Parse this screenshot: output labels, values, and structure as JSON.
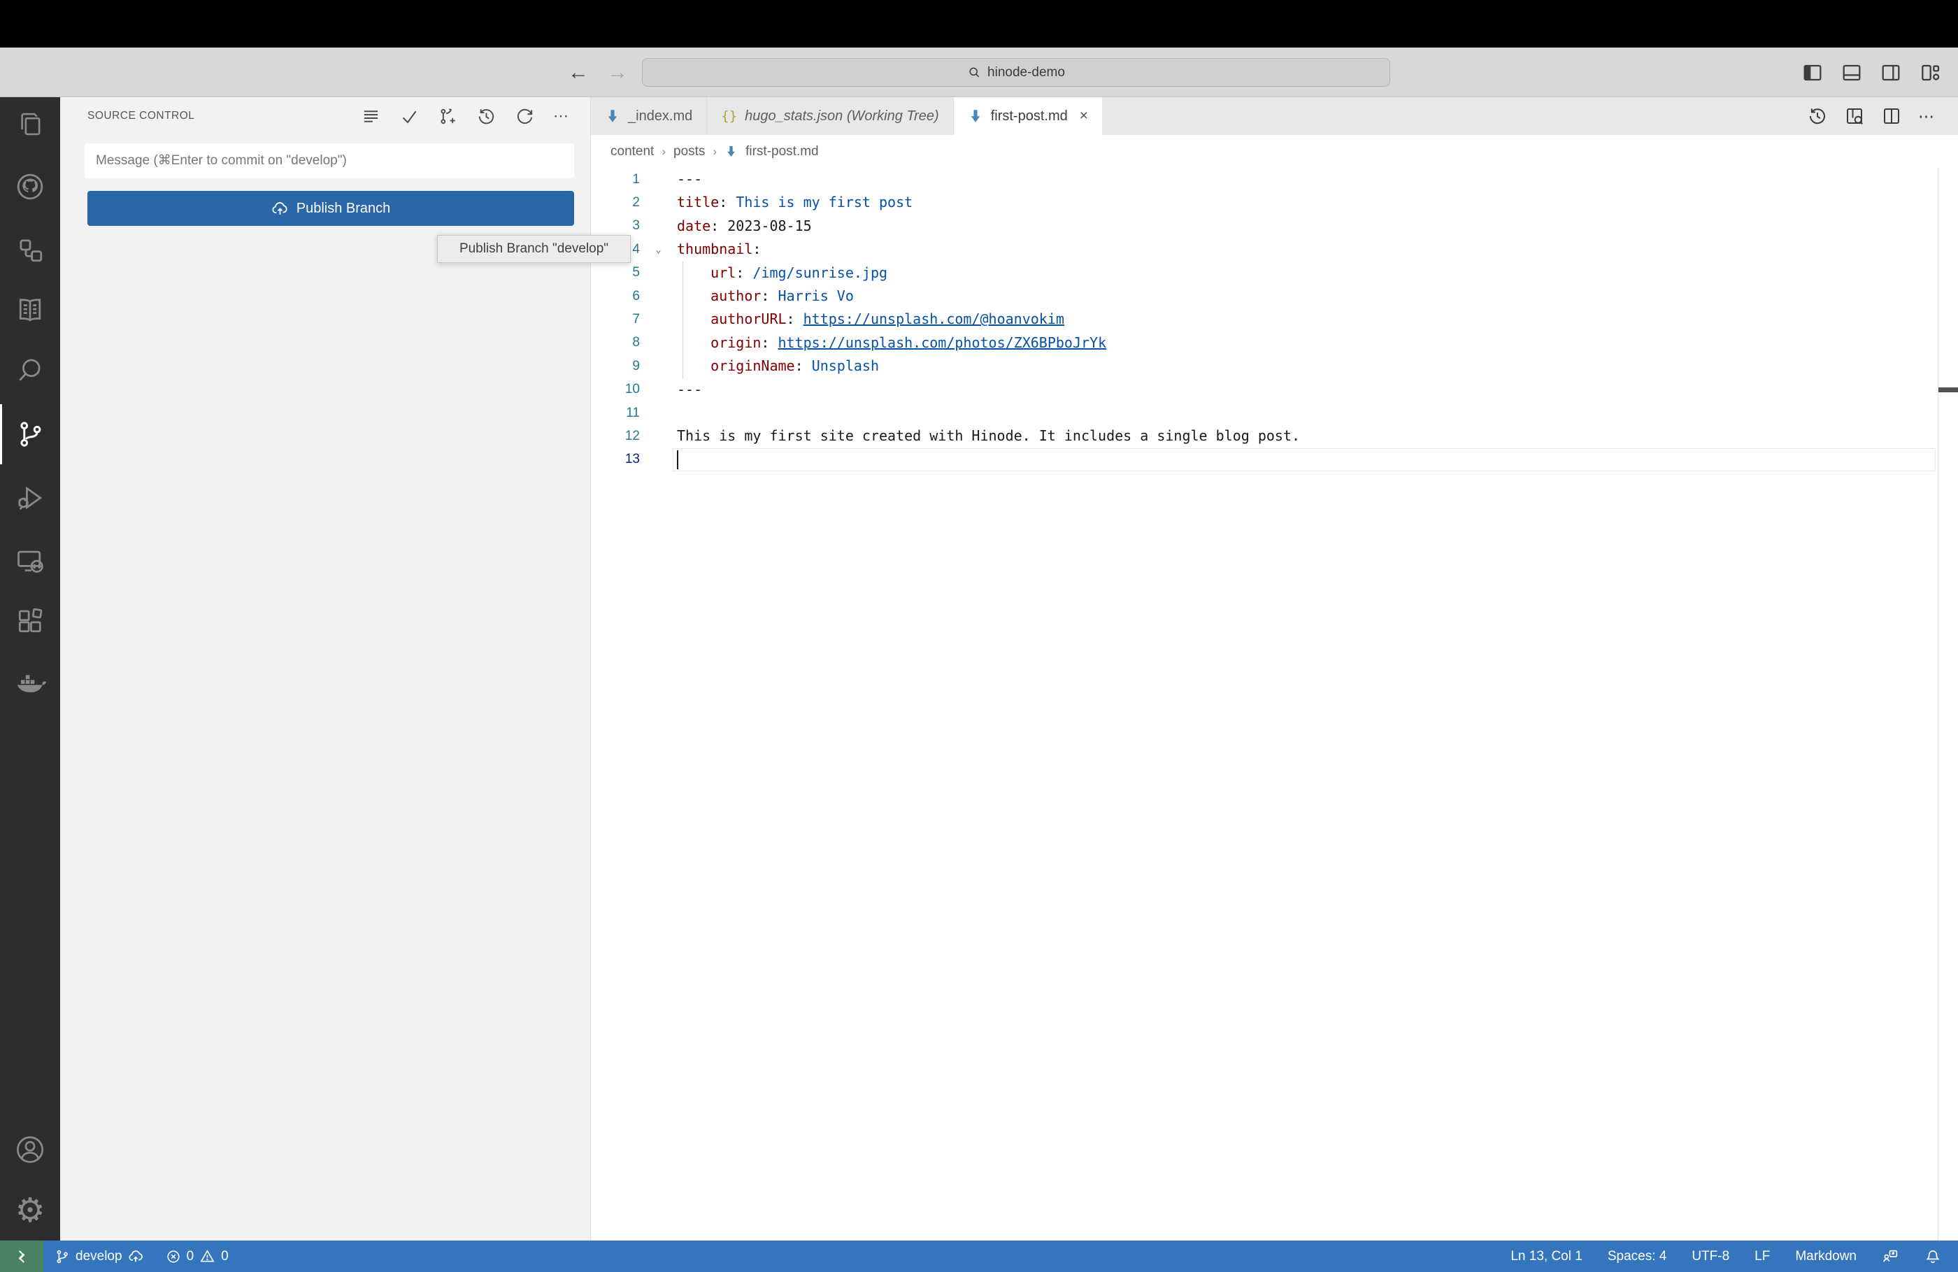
{
  "titlebar": {
    "search_text": "hinode-demo",
    "back_glyph": "←",
    "forward_glyph": "→",
    "layout_icons": [
      "toggle-primary-sidebar-icon",
      "toggle-panel-icon",
      "toggle-secondary-sidebar-icon",
      "customize-layout-icon"
    ]
  },
  "activity_bar": {
    "icons": [
      "explorer-icon",
      "github-icon",
      "hierarchy-icon",
      "book-icon",
      "search-icon",
      "source-control-icon",
      "run-debug-icon",
      "remote-explorer-icon",
      "extensions-icon",
      "docker-icon",
      "accounts-icon",
      "settings-gear-icon"
    ],
    "active_item": "source-control",
    "gear_glyph": "⚙"
  },
  "source_control": {
    "title": "SOURCE CONTROL",
    "toolbar_icons": [
      "view-as-list-icon",
      "commit-check-icon",
      "create-branch-icon",
      "history-icon",
      "refresh-icon",
      "more-actions-ellipsis"
    ],
    "more_actions_glyph": "⋯",
    "message_placeholder": "Message (⌘Enter to commit on \"develop\")",
    "publish_label": "Publish Branch",
    "tooltip": "Publish Branch \"develop\""
  },
  "tabs": [
    {
      "label": "_index.md",
      "icon": "markdown"
    },
    {
      "label": "hugo_stats.json (Working Tree)",
      "icon": "json",
      "json_glyph": "{}"
    },
    {
      "label": "first-post.md",
      "icon": "markdown",
      "close_glyph": "×"
    }
  ],
  "editor_actions": {
    "icons": [
      "timeline-history-icon",
      "open-preview-icon",
      "split-editor-icon",
      "more-actions-ellipsis"
    ],
    "ellipsis_glyph": "⋯"
  },
  "breadcrumb": {
    "items": [
      "content",
      "posts",
      "first-post.md"
    ],
    "separator": "›"
  },
  "editor": {
    "lines": [
      {
        "num": "1",
        "segments": [
          {
            "t": "---"
          }
        ]
      },
      {
        "num": "2",
        "segments": [
          {
            "t": "title"
          },
          {
            "t": ": "
          },
          {
            "t": "This is my first post"
          }
        ]
      },
      {
        "num": "3",
        "segments": [
          {
            "t": "date"
          },
          {
            "t": ": "
          },
          {
            "t": "2023-08-15"
          }
        ]
      },
      {
        "num": "4",
        "segments": [
          {
            "t": "thumbnail"
          },
          {
            "t": ":"
          }
        ],
        "fold": "⌄"
      },
      {
        "num": "5",
        "segments": [
          {
            "t": "    "
          },
          {
            "t": "url"
          },
          {
            "t": ": "
          },
          {
            "t": "/img/sunrise.jpg"
          }
        ]
      },
      {
        "num": "6",
        "segments": [
          {
            "t": "    "
          },
          {
            "t": "author"
          },
          {
            "t": ": "
          },
          {
            "t": "Harris Vo"
          }
        ]
      },
      {
        "num": "7",
        "segments": [
          {
            "t": "    "
          },
          {
            "t": "authorURL"
          },
          {
            "t": ": "
          },
          {
            "t": "https://unsplash.com/@hoanvokim"
          }
        ]
      },
      {
        "num": "8",
        "segments": [
          {
            "t": "    "
          },
          {
            "t": "origin"
          },
          {
            "t": ": "
          },
          {
            "t": "https://unsplash.com/photos/ZX6BPboJrYk"
          }
        ]
      },
      {
        "num": "9",
        "segments": [
          {
            "t": "    "
          },
          {
            "t": "originName"
          },
          {
            "t": ": "
          },
          {
            "t": "Unsplash"
          }
        ]
      },
      {
        "num": "10",
        "segments": [
          {
            "t": "---"
          }
        ]
      },
      {
        "num": "11",
        "segments": []
      },
      {
        "num": "12",
        "segments": [
          {
            "t": "This is my first site created with Hinode. It includes a single blog post."
          }
        ]
      },
      {
        "num": "13",
        "segments": []
      }
    ]
  },
  "status_bar": {
    "remote_icon": "remote-indicator-icon",
    "branch": "develop",
    "errors": "0",
    "warnings": "0",
    "line_col": "Ln 13, Col 1",
    "indentation": "Spaces: 4",
    "encoding": "UTF-8",
    "eol": "LF",
    "language": "Markdown"
  },
  "colors": {
    "status_blue": "#3575bd",
    "remote_green": "#4a8262",
    "button_blue": "#2a67a9",
    "markdown_icon_blue": "#4a86b8",
    "json_icon_olive": "#a6a632",
    "yaml_key": "#800000",
    "yaml_string": "#0451a5"
  }
}
